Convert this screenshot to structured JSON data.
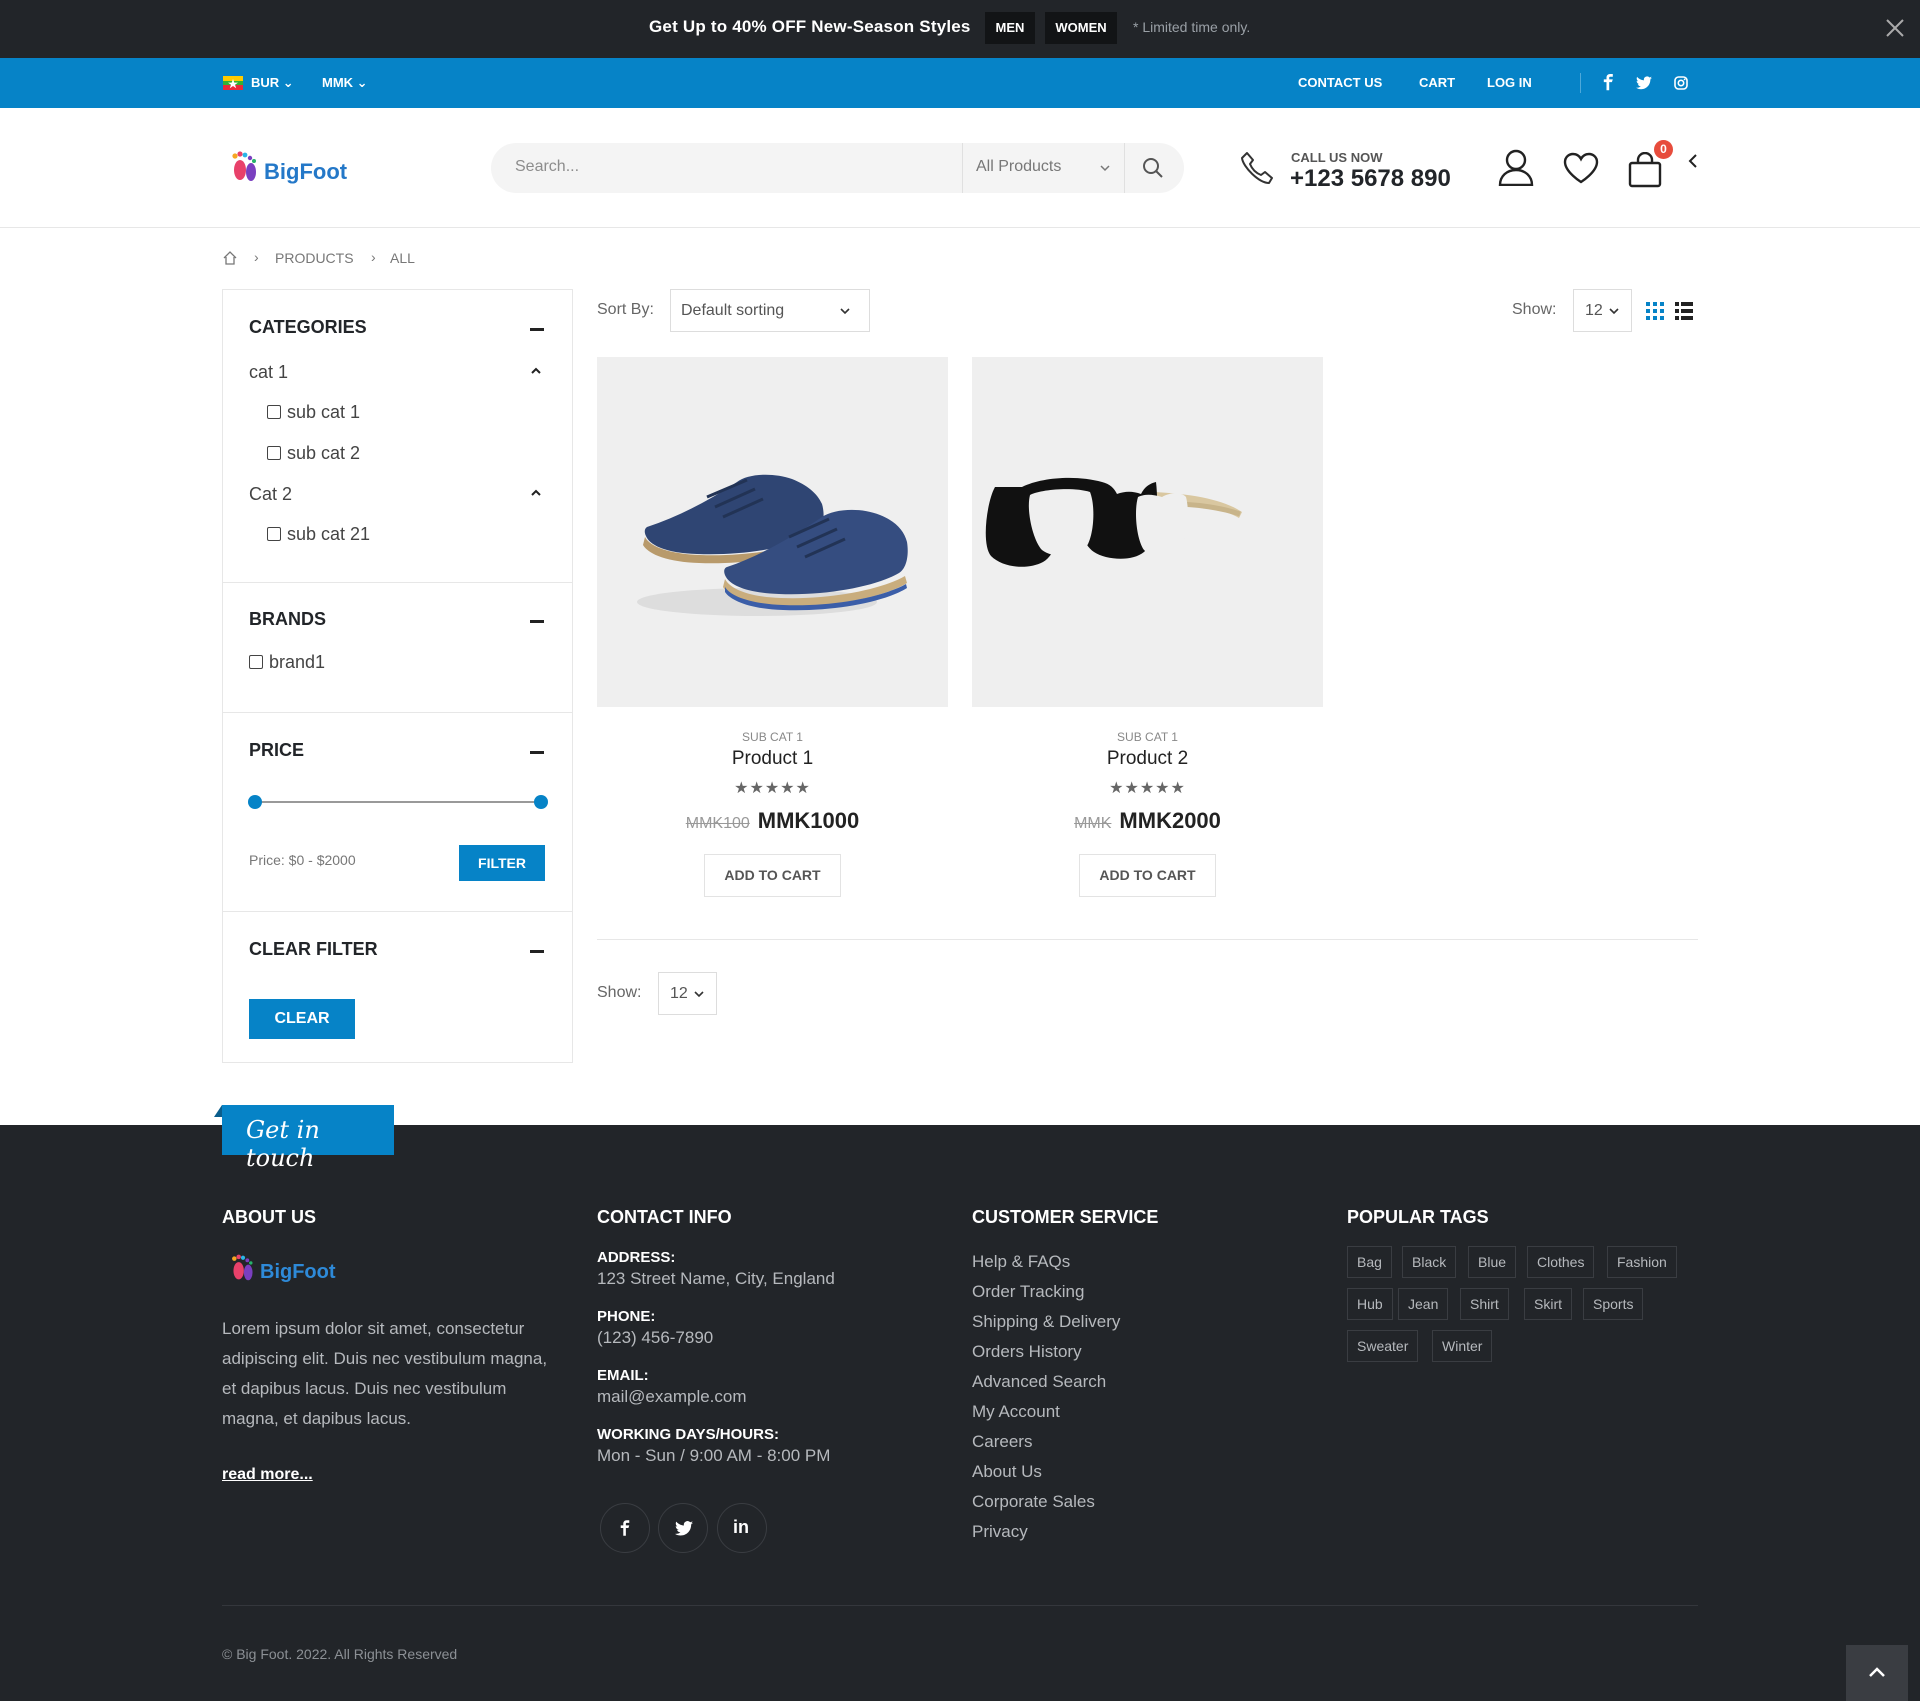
{
  "promo": {
    "text_before": "Get Up to ",
    "text_bold": "40% OFF",
    "text_after": " New-Season Styles",
    "tag_men": "MEN",
    "tag_women": "WOMEN",
    "limited": "* Limited time only."
  },
  "topbar": {
    "language": "BUR",
    "currency": "MMK",
    "links": [
      "CONTACT US",
      "CART",
      "LOG IN"
    ]
  },
  "header": {
    "logo": "BigFoot",
    "search_placeholder": "Search...",
    "search_category": "All Products",
    "call_label": "CALL US NOW",
    "phone": "+123 5678 890",
    "cart_count": "0"
  },
  "breadcrumb": {
    "items": [
      "PRODUCTS",
      "ALL"
    ]
  },
  "sidebar": {
    "categories_title": "CATEGORIES",
    "cat1": "cat 1",
    "cat1_subs": [
      "sub cat 1",
      "sub cat 2"
    ],
    "cat2": "Cat 2",
    "cat2_subs": [
      "sub cat 21"
    ],
    "brands_title": "BRANDS",
    "brands": [
      "brand1"
    ],
    "price_title": "PRICE",
    "price_text": "Price: $0 - $2000",
    "price_range_fraction": [
      0,
      1
    ],
    "filter_button": "FILTER",
    "clear_title": "CLEAR FILTER",
    "clear_button": "CLEAR"
  },
  "toolbar": {
    "sort_label": "Sort By:",
    "sort_value": "Default sorting",
    "show_label": "Show:",
    "show_value": "12"
  },
  "products": [
    {
      "category": "SUB CAT 1",
      "name": "Product 1",
      "stars": "★★★★★",
      "old_price": "MMK100",
      "price": "MMK1000",
      "button": "ADD TO CART"
    },
    {
      "category": "SUB CAT 1",
      "name": "Product 2",
      "stars": "★★★★★",
      "old_price": "MMK",
      "price": "MMK2000",
      "button": "ADD TO CART"
    }
  ],
  "bottom_toolbar": {
    "show_label": "Show:",
    "show_value": "12"
  },
  "footer": {
    "get_in_touch": "Get in touch",
    "about_title": "ABOUT US",
    "logo": "BigFoot",
    "about_text": "Lorem ipsum dolor sit amet, consectetur adipiscing elit. Duis nec vestibulum magna, et dapibus lacus. Duis nec vestibulum magna, et dapibus lacus.",
    "read_more": "read more...",
    "contact_title": "CONTACT INFO",
    "address_label": "ADDRESS:",
    "address": "123 Street Name, City, England",
    "phone_label": "PHONE:",
    "phone": "(123) 456-7890",
    "email_label": "EMAIL:",
    "email": "mail@example.com",
    "hours_label": "WORKING DAYS/HOURS:",
    "hours": "Mon - Sun / 9:00 AM - 8:00 PM",
    "service_title": "CUSTOMER SERVICE",
    "service_links": [
      "Help & FAQs",
      "Order Tracking",
      "Shipping & Delivery",
      "Orders History",
      "Advanced Search",
      "My Account",
      "Careers",
      "About Us",
      "Corporate Sales",
      "Privacy"
    ],
    "tags_title": "POPULAR TAGS",
    "tags": [
      "Bag",
      "Black",
      "Blue",
      "Clothes",
      "Fashion",
      "Hub",
      "Jean",
      "Shirt",
      "Skirt",
      "Sports",
      "Sweater",
      "Winter"
    ],
    "copyright": "© Big Foot. 2022. All Rights Reserved"
  },
  "colors": {
    "accent": "#0683c7",
    "dark": "#222529",
    "badge": "#e74c3c"
  }
}
